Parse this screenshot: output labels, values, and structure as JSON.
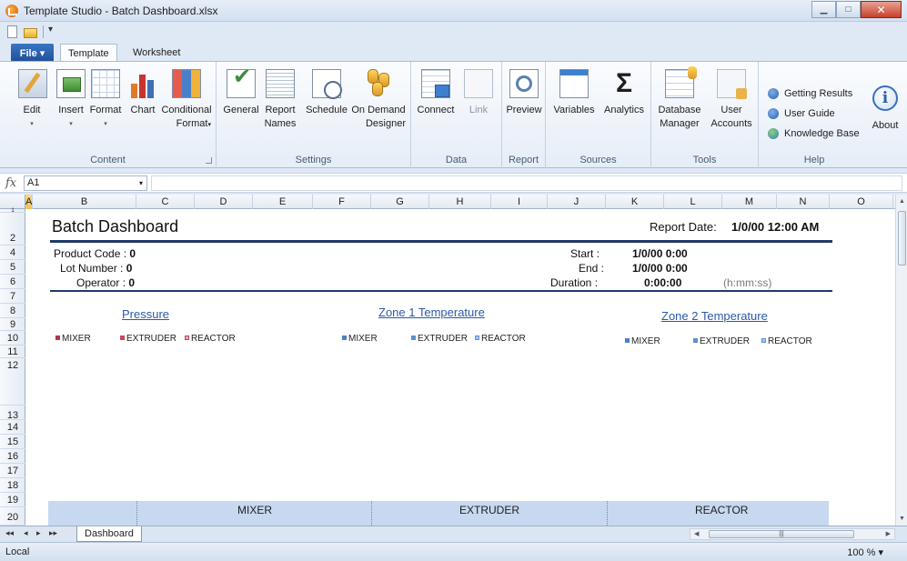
{
  "window": {
    "title": "Template Studio - Batch Dashboard.xlsx"
  },
  "qat": {
    "more": "▾"
  },
  "tabs": {
    "file": "File ▾",
    "template": "Template",
    "worksheet": "Worksheet"
  },
  "ribbon": {
    "content": {
      "label": "Content",
      "edit": "Edit",
      "insert": "Insert",
      "format": "Format",
      "chart": "Chart",
      "conditional": "Conditional",
      "conditional2": "Format",
      "caret": "▾"
    },
    "settings": {
      "label": "Settings",
      "general": "General",
      "report": "Report",
      "report2": "Names",
      "schedule": "Schedule",
      "ondemand": "On Demand",
      "ondemand2": "Designer"
    },
    "data": {
      "label": "Data",
      "connect": "Connect",
      "link": "Link"
    },
    "report": {
      "label": "Report",
      "preview": "Preview"
    },
    "sources": {
      "label": "Sources",
      "variables": "Variables",
      "analytics": "Analytics",
      "sigma": "Σ"
    },
    "tools": {
      "label": "Tools",
      "database": "Database",
      "database2": "Manager",
      "user": "User",
      "user2": "Accounts"
    },
    "help": {
      "label": "Help",
      "getting_results": "Getting Results",
      "user_guide": "User Guide",
      "knowledge_base": "Knowledge Base",
      "about": "About",
      "about_glyph": "i"
    }
  },
  "formula_bar": {
    "fx": "fx",
    "cell_ref": "A1",
    "dropdown": "▾",
    "value": ""
  },
  "columns": [
    "A",
    "B",
    "C",
    "D",
    "E",
    "F",
    "G",
    "H",
    "I",
    "J",
    "K",
    "L",
    "M",
    "N",
    "O"
  ],
  "rows": [
    "1",
    "2",
    "4",
    "5",
    "6",
    "7",
    "8",
    "9",
    "10",
    "11",
    "12",
    "13",
    "14",
    "15",
    "16",
    "17",
    "18",
    "19",
    "20"
  ],
  "dashboard": {
    "title": "Batch Dashboard",
    "report_date_label": "Report Date:",
    "report_date_value": "1/0/00 12:00 AM",
    "product_code": {
      "label": "Product Code :",
      "value": "0"
    },
    "lot_number": {
      "label": "Lot Number :",
      "value": "0"
    },
    "operator": {
      "label": "Operator :",
      "value": "0"
    },
    "start": {
      "label": "Start :",
      "value": "1/0/00 0:00"
    },
    "end": {
      "label": "End :",
      "value": "1/0/00 0:00"
    },
    "duration": {
      "label": "Duration :",
      "value": "0:00:00",
      "hint": "(h:mm:ss)"
    },
    "zones": [
      {
        "title": "Pressure",
        "legend": [
          "MIXER",
          "EXTRUDER",
          "REACTOR"
        ]
      },
      {
        "title": "Zone 1 Temperature",
        "legend": [
          "MIXER",
          "EXTRUDER",
          "REACTOR"
        ]
      },
      {
        "title": "Zone 2 Temperature",
        "legend": [
          "MIXER",
          "EXTRUDER",
          "REACTOR"
        ]
      }
    ],
    "table_groups": [
      "MIXER",
      "EXTRUDER",
      "REACTOR"
    ]
  },
  "sheet_tabs": {
    "nav": [
      "◂◂",
      "◂",
      "▸",
      "▸▸"
    ],
    "active": "Dashboard"
  },
  "status": {
    "left": "Local",
    "zoom": "100 % ▾"
  },
  "colors": {
    "accent": "#1f3a6a",
    "link": "#2a5aa8",
    "table_header": "#c6d9f0"
  }
}
